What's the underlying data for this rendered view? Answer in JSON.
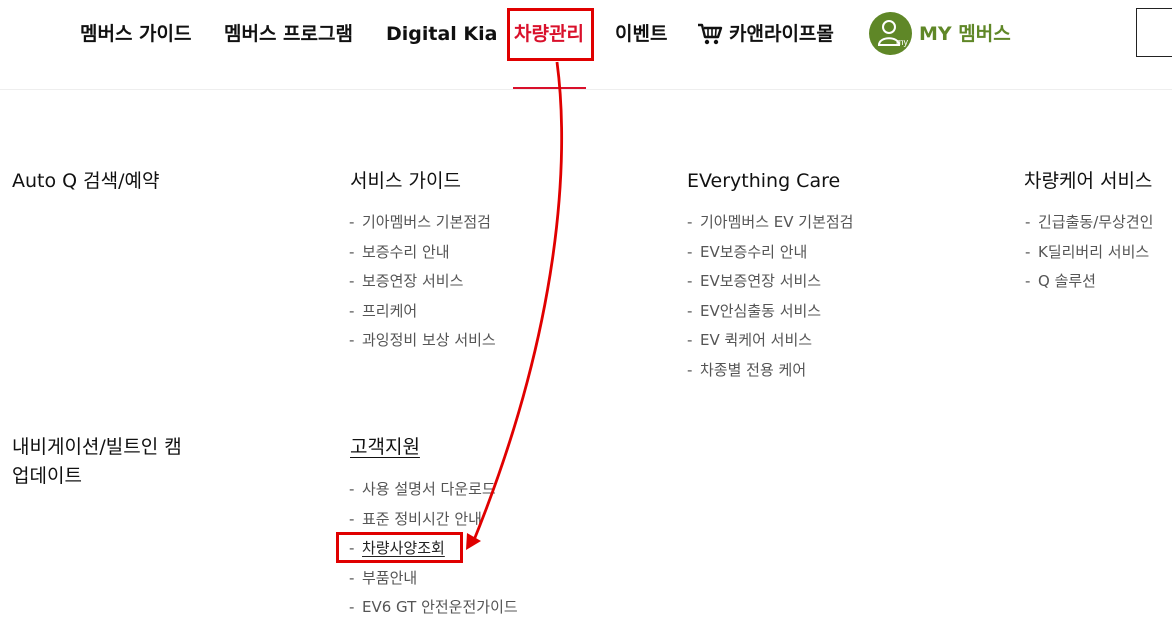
{
  "nav": {
    "items": [
      {
        "label": "멤버스 가이드"
      },
      {
        "label": "멤버스 프로그램"
      },
      {
        "label": "Digital Kia"
      },
      {
        "label": "차량관리"
      },
      {
        "label": "이벤트"
      },
      {
        "label": "카앤라이프몰"
      },
      {
        "label": "MY 멤버스"
      }
    ],
    "avatar_text": "my",
    "active_color": "#d9102b",
    "my_color": "#5f8727"
  },
  "menu": {
    "columns": [
      {
        "sections": [
          {
            "title": "Auto Q 검색/예약",
            "items": []
          },
          {
            "title_lines": [
              "내비게이션/빌트인 캠",
              "업데이트"
            ],
            "items": []
          }
        ]
      },
      {
        "sections": [
          {
            "title": "서비스 가이드",
            "items": [
              "기아멤버스 기본점검",
              "보증수리 안내",
              "보증연장 서비스",
              "프리케어",
              "과잉정비 보상 서비스"
            ]
          },
          {
            "title": "고객지원",
            "items": [
              "사용 설명서 다운로드",
              "표준 정비시간 안내",
              "차량사양조회",
              "부품안내",
              "EV6 GT 안전운전가이드"
            ]
          }
        ]
      },
      {
        "sections": [
          {
            "title": "EVerything Care",
            "items": [
              "기아멤버스 EV 기본점검",
              "EV보증수리 안내",
              "EV보증연장 서비스",
              "EV안심출동 서비스",
              "EV 퀵케어 서비스",
              "차종별 전용 케어"
            ]
          }
        ]
      },
      {
        "sections": [
          {
            "title": "차량케어 서비스",
            "items": [
              "긴급출동/무상견인",
              "K딜리버리 서비스",
              "Q 솔루션"
            ]
          }
        ]
      }
    ],
    "dash": "-"
  },
  "annotation": {
    "color": "#e00000"
  }
}
